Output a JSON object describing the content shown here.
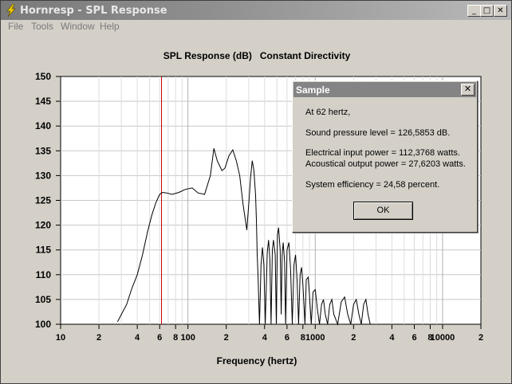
{
  "window": {
    "title": "Hornresp - SPL Response",
    "controls": {
      "minimize": "_",
      "maximize": "□",
      "close": "✕"
    }
  },
  "menu": {
    "items": [
      "File",
      "Tools",
      "Window",
      "Help"
    ]
  },
  "chart_data": {
    "type": "line",
    "title": "SPL Response (dB)   Constant Directivity",
    "xlabel": "Frequency (hertz)",
    "ylabel": "",
    "x_scale": "log",
    "xlim": [
      10,
      20000
    ],
    "ylim": [
      100,
      150
    ],
    "grid": true,
    "y_ticks": [
      100,
      105,
      110,
      115,
      120,
      125,
      130,
      135,
      140,
      145,
      150
    ],
    "x_tick_labels": [
      {
        "f": 10,
        "label": "10"
      },
      {
        "f": 20,
        "label": "2"
      },
      {
        "f": 40,
        "label": "4"
      },
      {
        "f": 60,
        "label": "6"
      },
      {
        "f": 80,
        "label": "8"
      },
      {
        "f": 100,
        "label": "100"
      },
      {
        "f": 200,
        "label": "2"
      },
      {
        "f": 400,
        "label": "4"
      },
      {
        "f": 600,
        "label": "6"
      },
      {
        "f": 800,
        "label": "8"
      },
      {
        "f": 1000,
        "label": "1000"
      },
      {
        "f": 2000,
        "label": "2"
      },
      {
        "f": 4000,
        "label": "4"
      },
      {
        "f": 6000,
        "label": "6"
      },
      {
        "f": 8000,
        "label": "8"
      },
      {
        "f": 10000,
        "label": "10000"
      },
      {
        "f": 20000,
        "label": "2"
      }
    ],
    "marker_frequency": 62,
    "series": [
      {
        "line_color": "#000000",
        "x": [
          28,
          30,
          33,
          36,
          40,
          44,
          48,
          52,
          56,
          60,
          63,
          68,
          75,
          85,
          95,
          108,
          120,
          135,
          150,
          160,
          170,
          185,
          195,
          210,
          225,
          240,
          255,
          270,
          290,
          300,
          310,
          320,
          330,
          340,
          345,
          350,
          355,
          360,
          365,
          375,
          385,
          395,
          405,
          420,
          430,
          440,
          450,
          460,
          470,
          485,
          495,
          505,
          515,
          530,
          540,
          550,
          560,
          575,
          585,
          600,
          620,
          640,
          660,
          680,
          700,
          720,
          740,
          760,
          780,
          800,
          830,
          850,
          880,
          900,
          930,
          960,
          1000,
          1040,
          1080,
          1120,
          1160,
          1200,
          1250,
          1300,
          1350,
          1400,
          1500,
          1600,
          1700,
          1800,
          1900,
          2000,
          2100,
          2200,
          2300,
          2400,
          2500,
          2600,
          2700,
          2800
        ],
        "y": [
          100.5,
          102,
          104,
          107,
          110,
          114,
          118.5,
          122,
          124.5,
          126.2,
          126.6,
          126.5,
          126.2,
          126.6,
          127.2,
          127.5,
          126.5,
          126.2,
          130,
          135.5,
          133,
          131,
          131.5,
          134,
          135.2,
          133,
          130,
          124.5,
          119,
          124,
          129.5,
          133,
          131,
          126,
          121,
          114,
          110,
          104.5,
          100,
          112,
          115.5,
          112,
          100,
          114.5,
          117,
          113,
          100,
          115,
          117,
          114,
          100,
          118,
          119.5,
          115,
          102,
          114,
          116.5,
          112.5,
          100,
          115,
          116.5,
          111,
          100,
          112,
          114,
          109,
          100,
          110,
          111.5,
          108,
          100,
          109,
          109.5,
          106,
          100,
          106.5,
          107,
          103,
          100,
          104,
          105,
          102,
          100,
          104,
          105,
          102,
          100,
          104.5,
          105.5,
          102,
          100,
          104,
          105,
          102,
          100,
          104,
          105,
          102,
          100,
          100
        ]
      }
    ]
  },
  "dialog": {
    "title": "Sample",
    "close": "✕",
    "lines": [
      "At 62 hertz,",
      "Sound pressure level = 126,5853 dB.",
      "Electrical input power = 112,3768 watts.",
      "Acoustical output power = 27,6203 watts.",
      "System efficiency = 24,58 percent."
    ],
    "ok_label": "OK"
  }
}
